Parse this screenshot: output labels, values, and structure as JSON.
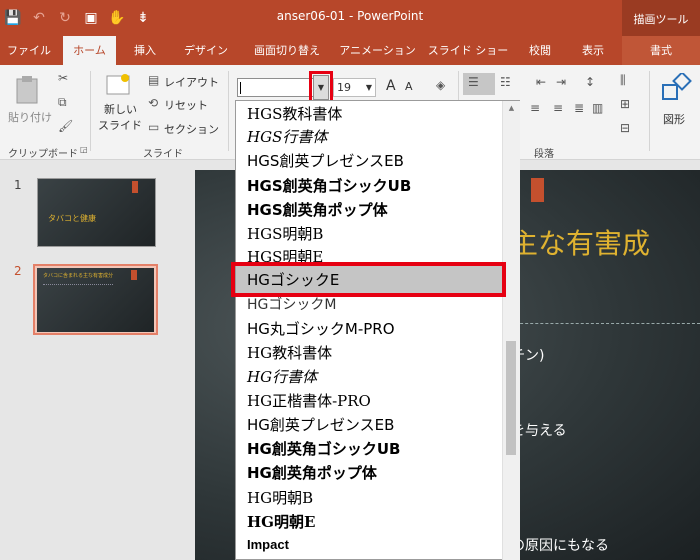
{
  "window": {
    "title": "anser06-01  -  PowerPoint"
  },
  "qat": {
    "save_icon": "💾",
    "undo_icon": "↶",
    "redo_icon": "↻",
    "present_icon": "▣",
    "touch_icon": "✋",
    "customize_icon": "⇟"
  },
  "tabs": [
    "ファイル",
    "ホーム",
    "挿入",
    "デザイン",
    "画面切り替え",
    "アニメーション",
    "スライド ショー",
    "校閲",
    "表示"
  ],
  "context_tab": {
    "group_label": "描画ツール",
    "tab_label": "書式"
  },
  "ribbon": {
    "clipboard": {
      "paste_label": "貼り付け",
      "group_label": "クリップボード"
    },
    "slides": {
      "new_slide_label1": "新しい",
      "new_slide_label2": "スライド",
      "layout_label": "レイアウト",
      "reset_label": "リセット",
      "section_label": "セクション",
      "group_label": "スライド"
    },
    "font": {
      "name_value": "",
      "size_value": "19",
      "increase_label": "A",
      "decrease_label": "A"
    },
    "paragraph": {
      "group_label": "段落"
    },
    "drawing": {
      "shapes_label": "図形"
    }
  },
  "slides": [
    {
      "number": "1",
      "title": "タバコと健康"
    },
    {
      "number": "2",
      "title": "タバコに含まれる主な有害成分"
    }
  ],
  "slide_view": {
    "title": "る主な有害成",
    "lines": [
      "チン)",
      "を与える",
      "の原因にもなる"
    ]
  },
  "font_list": [
    "HGS教科書体",
    "HGS行書体",
    "HGS創英プレゼンスEB",
    "HGS創英角ゴシックUB",
    "HGS創英角ポップ体",
    "HGS明朝B",
    "HGS明朝E",
    "HGゴシックE",
    "HGゴシックM",
    "HG丸ゴシックM-PRO",
    "HG教科書体",
    "HG行書体",
    "HG正楷書体-PRO",
    "HG創英プレゼンスEB",
    "HG創英角ゴシックUB",
    "HG創英角ポップ体",
    "HG明朝B",
    "HG明朝E",
    "Impact"
  ],
  "selected_font_index": 7,
  "highlight_color": "#e60012",
  "accent_color": "#b7472a"
}
